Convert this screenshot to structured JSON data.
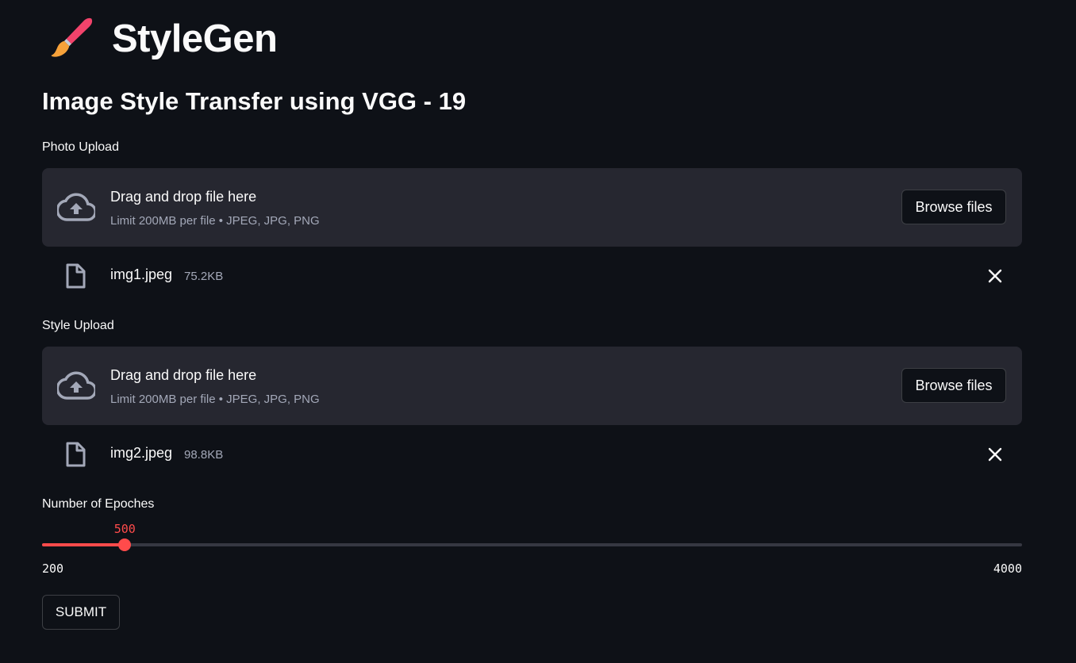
{
  "app": {
    "title": "StyleGen",
    "icon": "paintbrush-icon",
    "subtitle": "Image Style Transfer using VGG - 19"
  },
  "photo_upload": {
    "label": "Photo Upload",
    "drop_text": "Drag and drop file here",
    "limit_text": "Limit 200MB per file • JPEG, JPG, PNG",
    "browse_label": "Browse files",
    "file": {
      "name": "img1.jpeg",
      "size": "75.2KB"
    }
  },
  "style_upload": {
    "label": "Style Upload",
    "drop_text": "Drag and drop file here",
    "limit_text": "Limit 200MB per file • JPEG, JPG, PNG",
    "browse_label": "Browse files",
    "file": {
      "name": "img2.jpeg",
      "size": "98.8KB"
    }
  },
  "epochs": {
    "label": "Number of Epoches",
    "value": 500,
    "min": 200,
    "max": 4000,
    "value_text": "500",
    "min_text": "200",
    "max_text": "4000"
  },
  "submit_label": "SUBMIT",
  "colors": {
    "background": "#0e1117",
    "panel": "#262730",
    "accent": "#ff4b4b",
    "muted_text": "#a3a8b8"
  }
}
